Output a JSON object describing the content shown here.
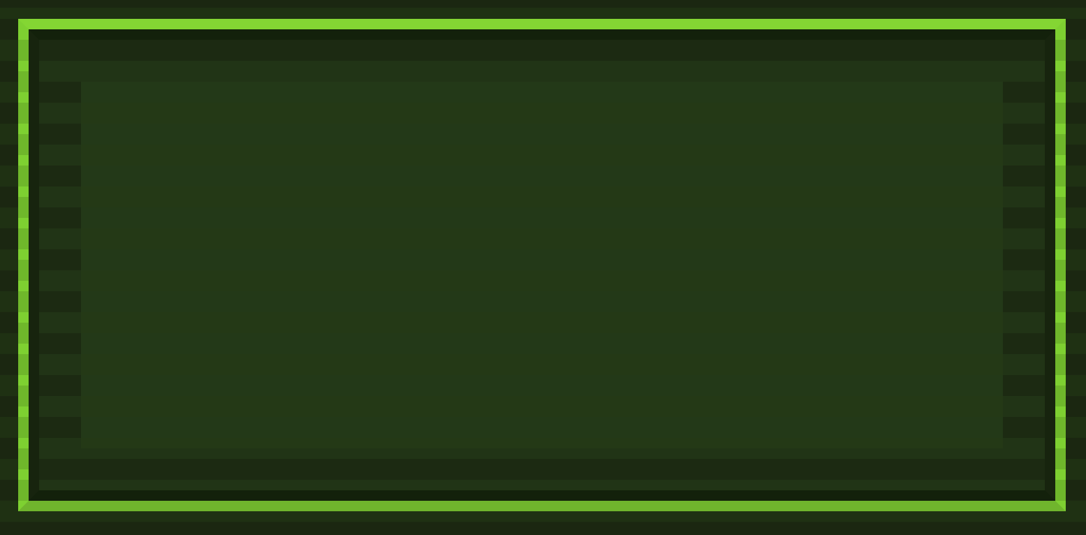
{
  "screen": {
    "state": "empty-panel",
    "colors": {
      "background": "#1a2410",
      "frame": "#84d633",
      "frame_shadow": "#70b52d",
      "panel_fill": "#233918",
      "scanline": "#1f3214"
    }
  }
}
